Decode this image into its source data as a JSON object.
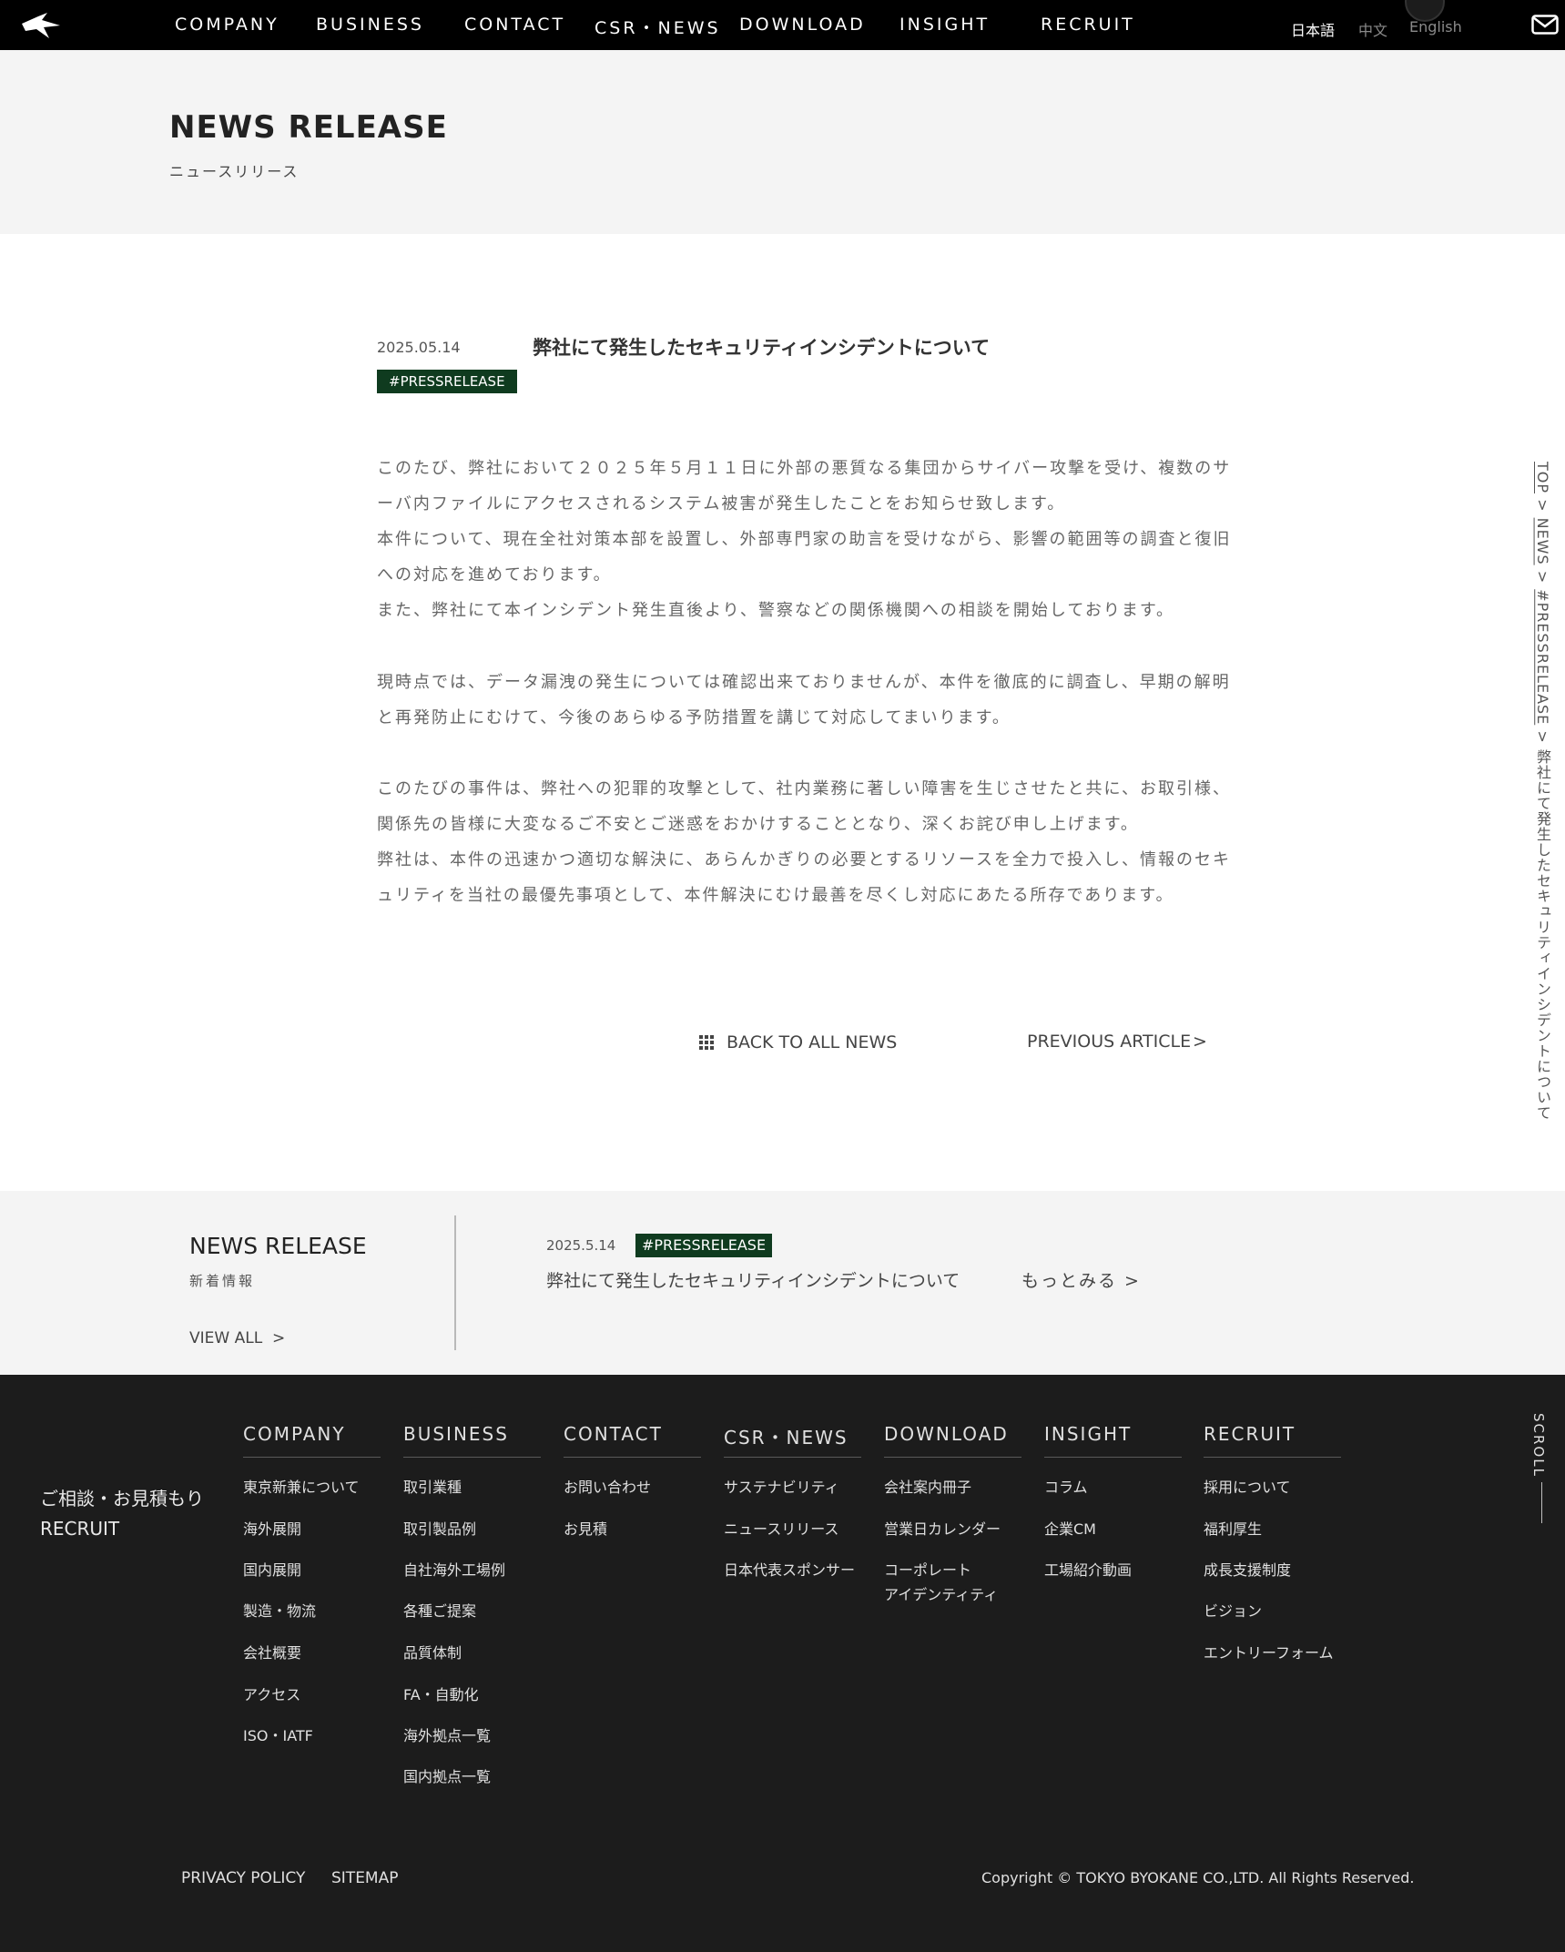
{
  "header": {
    "nav": [
      "COMPANY",
      "BUSINESS",
      "CONTACT",
      "CSR・NEWS",
      "DOWNLOAD",
      "INSIGHT",
      "RECRUIT"
    ],
    "languages": [
      "日本語",
      "中文",
      "English"
    ],
    "active_language": "日本語"
  },
  "page": {
    "title": "NEWS RELEASE",
    "subtitle": "ニュースリリース"
  },
  "article": {
    "date": "2025.05.14",
    "title": "弊社にて発生したセキュリティインシデントについて",
    "tag": "#PRESSRELEASE",
    "body_lines": [
      "このたび、弊社において２０２５年５月１１日に外部の悪質なる集団からサイバー攻撃を受け、複数のサ",
      "ーバ内ファイルにアクセスされるシステム被害が発生したことをお知らせ致します。",
      "本件について、現在全社対策本部を設置し、外部専門家の助言を受けながら、影響の範囲等の調査と復旧",
      "への対応を進めております。",
      "また、弊社にて本インシデント発生直後より、警察などの関係機関への相談を開始しております。",
      "現時点では、データ漏洩の発生については確認出来ておりませんが、本件を徹底的に調査し、早期の解明",
      "と再発防止にむけて、今後のあらゆる予防措置を講じて対応してまいります。",
      "このたびの事件は、弊社への犯罪的攻撃として、社内業務に著しい障害を生じさせたと共に、お取引様、",
      "関係先の皆様に大変なるご不安とご迷惑をおかけすることとなり、深くお詫び申し上げます。",
      "弊社は、本件の迅速かつ適切な解決に、あらんかぎりの必要とするリソースを全力で投入し、情報のセキ",
      "ュリティを当社の最優先事項として、本件解決にむけ最善を尽くし対応にあたる所存であります。"
    ],
    "back_label": "BACK TO ALL NEWS",
    "prev_label": "PREVIOUS ARTICLE",
    "prev_arrow": ">"
  },
  "breadcrumb": {
    "items": [
      "TOP",
      "NEWS",
      "#PRESSRELEASE",
      "弊社にて発生したセキュリティインシデントについて"
    ],
    "separator": " > "
  },
  "news_strip": {
    "title": "NEWS RELEASE",
    "subtitle": "新着情報",
    "view_all": "VIEW ALL",
    "view_all_arrow": ">",
    "date": "2025.5.14",
    "tag": "#PRESSRELEASE",
    "headline": "弊社にて発生したセキュリティインシデントについて",
    "more": "もっとみる >"
  },
  "footer": {
    "side_links": [
      "ご相談・お見積もり",
      "RECRUIT"
    ],
    "columns": [
      {
        "head": "COMPANY",
        "items": [
          "東京新兼について",
          "海外展開",
          "国内展開",
          "製造・物流",
          "会社概要",
          "アクセス",
          "ISO・IATF"
        ]
      },
      {
        "head": "BUSINESS",
        "items": [
          "取引業種",
          "取引製品例",
          "自社海外工場例",
          "各種ご提案",
          "品質体制",
          "FA・自動化",
          "海外拠点一覧",
          "国内拠点一覧"
        ]
      },
      {
        "head": "CONTACT",
        "items": [
          "お問い合わせ",
          "お見積"
        ]
      },
      {
        "head": "CSR・NEWS",
        "items": [
          "サステナビリティ",
          "ニュースリリース",
          "日本代表スポンサー"
        ]
      },
      {
        "head": "DOWNLOAD",
        "items": [
          "会社案内冊子",
          "営業日カレンダー",
          "コーポレート\nアイデンティティ"
        ]
      },
      {
        "head": "INSIGHT",
        "items": [
          "コラム",
          "企業CM",
          "工場紹介動画"
        ]
      },
      {
        "head": "RECRUIT",
        "items": [
          "採用について",
          "福利厚生",
          "成長支援制度",
          "ビジョン",
          "エントリーフォーム"
        ]
      }
    ],
    "bottom_links": [
      "PRIVACY POLICY",
      "SITEMAP"
    ],
    "copyright": "Copyright © TOKYO BYOKANE CO.,LTD. All Rights Reserved.",
    "scroll_label": "SCROLL"
  },
  "icons": {
    "logo": "bird-logo-icon",
    "mail": "mail-icon",
    "grid": "grid-icon"
  },
  "colors": {
    "tag_green": "#0f3b1f",
    "footer_bg": "#1c1c1c",
    "header_bg": "#000000"
  }
}
